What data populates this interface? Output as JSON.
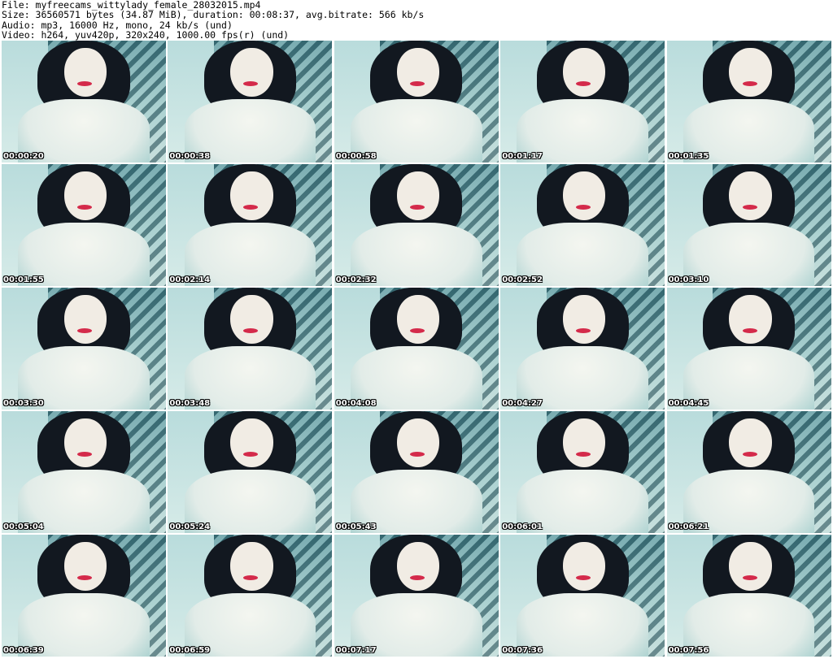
{
  "header": {
    "file": "File: myfreecams_wittylady_female_28032015.mp4",
    "size": "Size: 36560571 bytes (34.87 MiB), duration: 00:08:37, avg.bitrate: 566 kb/s",
    "audio": "Audio: mp3, 16000 Hz, mono, 24 kb/s (und)",
    "video": "Video: h264, yuv420p, 320x240, 1000.00 fps(r) (und)"
  },
  "thumbnails": [
    {
      "timestamp": "00:00:20"
    },
    {
      "timestamp": "00:00:38"
    },
    {
      "timestamp": "00:00:58"
    },
    {
      "timestamp": "00:01:17"
    },
    {
      "timestamp": "00:01:35"
    },
    {
      "timestamp": "00:01:55"
    },
    {
      "timestamp": "00:02:14"
    },
    {
      "timestamp": "00:02:32"
    },
    {
      "timestamp": "00:02:52"
    },
    {
      "timestamp": "00:03:10"
    },
    {
      "timestamp": "00:03:30"
    },
    {
      "timestamp": "00:03:48"
    },
    {
      "timestamp": "00:04:08"
    },
    {
      "timestamp": "00:04:27"
    },
    {
      "timestamp": "00:04:45"
    },
    {
      "timestamp": "00:05:04"
    },
    {
      "timestamp": "00:05:24"
    },
    {
      "timestamp": "00:05:43"
    },
    {
      "timestamp": "00:06:01"
    },
    {
      "timestamp": "00:06:21"
    },
    {
      "timestamp": "00:06:39"
    },
    {
      "timestamp": "00:06:59"
    },
    {
      "timestamp": "00:07:17"
    },
    {
      "timestamp": "00:07:36"
    },
    {
      "timestamp": "00:07:56"
    }
  ]
}
